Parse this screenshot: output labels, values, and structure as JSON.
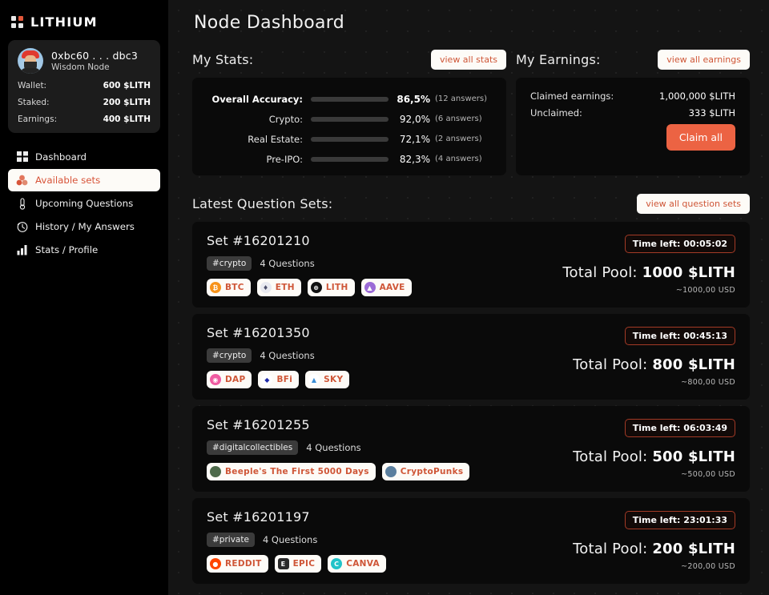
{
  "brand": {
    "name": "LITHIUM",
    "logo_icon": "four-dot-grid-icon",
    "accent": "#e2573a"
  },
  "profile": {
    "address": "0xbc60 . . . dbc3",
    "role": "Wisdom Node",
    "avatar_icon": "user-avatar",
    "rows": [
      {
        "label": "Wallet:",
        "value": "600 $LITH"
      },
      {
        "label": "Staked:",
        "value": "200 $LITH"
      },
      {
        "label": "Earnings:",
        "value": "400 $LITH"
      }
    ]
  },
  "sidebar": {
    "items": [
      {
        "label": "Dashboard",
        "icon": "grid-icon",
        "active": false
      },
      {
        "label": "Available sets",
        "icon": "cubes-icon",
        "active": true
      },
      {
        "label": "Upcoming Questions",
        "icon": "thermometer-icon",
        "active": false
      },
      {
        "label": "History / My Answers",
        "icon": "clock-icon",
        "active": false
      },
      {
        "label": "Stats / Profile",
        "icon": "bar-chart-icon",
        "active": false
      }
    ]
  },
  "header": {
    "title": "Node Dashboard"
  },
  "my_stats": {
    "title": "My Stats:",
    "view_all_label": "view all stats",
    "bar_color": "#e3573c",
    "track_color": "#3a3a3a",
    "rows": [
      {
        "label": "Overall Accuracy:",
        "percent": "86,5%",
        "value": 86.5,
        "answers": "(12 answers)",
        "primary": true
      },
      {
        "label": "Crypto:",
        "percent": "92,0%",
        "value": 92.0,
        "answers": "(6 answers)",
        "primary": false
      },
      {
        "label": "Real Estate:",
        "percent": "72,1%",
        "value": 72.1,
        "answers": "(2 answers)",
        "primary": false
      },
      {
        "label": "Pre-IPO:",
        "percent": "82,3%",
        "value": 82.3,
        "answers": "(4 answers)",
        "primary": false
      }
    ]
  },
  "my_earnings": {
    "title": "My Earnings:",
    "view_all_label": "view all earnings",
    "rows": [
      {
        "label": "Claimed earnings:",
        "value": "1,000,000 $LITH"
      },
      {
        "label": "Unclaimed:",
        "value": "333 $LITH"
      }
    ],
    "claim_label": "Claim all",
    "claim_color": "#ec6343"
  },
  "question_sets": {
    "title": "Latest Question Sets:",
    "view_all_label": "view all question sets",
    "timer_prefix": "Time left: ",
    "pool_prefix": "Total Pool: ",
    "cards": [
      {
        "set_id": "Set #16201210",
        "tag": "#crypto",
        "questions": "4 Questions",
        "timer": "Time left: 00:05:02",
        "pool_label": "Total Pool: ",
        "pool_value": "1000 $LITH",
        "usd": "~1000,00 USD",
        "chips": [
          {
            "label": "BTC",
            "icon": "bitcoin-icon",
            "glyph": "₿",
            "bg": "#f7931a",
            "shape": "circle"
          },
          {
            "label": "ETH",
            "icon": "ethereum-icon",
            "glyph": "♦",
            "bg": "#e9eaf0",
            "fg": "#4c4f6b",
            "shape": "circle"
          },
          {
            "label": "LITH",
            "icon": "lithium-icon",
            "glyph": "⊕",
            "bg": "#111111",
            "shape": "circle"
          },
          {
            "label": "AAVE",
            "icon": "aave-icon",
            "glyph": "▲",
            "bg": "#9b6bd6",
            "shape": "circle"
          }
        ]
      },
      {
        "set_id": "Set #16201350",
        "tag": "#crypto",
        "questions": "4 Questions",
        "timer": "Time left: 00:45:13",
        "pool_label": "Total Pool: ",
        "pool_value": "800 $LITH",
        "usd": "~800,00 USD",
        "chips": [
          {
            "label": "DAP",
            "icon": "dap-icon",
            "glyph": "◉",
            "bg": "#ef5ba1",
            "shape": "circle"
          },
          {
            "label": "BFi",
            "icon": "bfi-icon",
            "glyph": "◆",
            "bg": "#ffffff",
            "fg": "#1f2aa8",
            "shape": "circle"
          },
          {
            "label": "SKY",
            "icon": "sky-icon",
            "glyph": "▲",
            "bg": "#ffffff",
            "fg": "#3b8ed6",
            "shape": "circle"
          }
        ]
      },
      {
        "set_id": "Set #16201255",
        "tag": "#digitalcollectibles",
        "questions": "4 Questions",
        "timer": "Time left: 06:03:49",
        "pool_label": "Total Pool: ",
        "pool_value": "500 $LITH",
        "usd": "~500,00 USD",
        "chips": [
          {
            "label": "Beeple's The First 5000 Days",
            "icon": "beeple-artwork-icon",
            "glyph": "",
            "bg": "#4e6a4a",
            "shape": "circle"
          },
          {
            "label": "CryptoPunks",
            "icon": "cryptopunks-icon",
            "glyph": "",
            "bg": "#5b7f9e",
            "shape": "circle"
          }
        ]
      },
      {
        "set_id": "Set #16201197",
        "tag": "#private",
        "questions": "4 Questions",
        "timer": "Time left: 23:01:33",
        "pool_label": "Total Pool: ",
        "pool_value": "200 $LITH",
        "usd": "~200,00 USD",
        "chips": [
          {
            "label": "REDDIT",
            "icon": "reddit-icon",
            "glyph": "●",
            "bg": "#ff4500",
            "shape": "circle"
          },
          {
            "label": "EPIC",
            "icon": "epic-games-icon",
            "glyph": "E",
            "bg": "#2a2a2a",
            "shape": "sq"
          },
          {
            "label": "CANVA",
            "icon": "canva-icon",
            "glyph": "C",
            "bg": "#21c3c9",
            "shape": "circle"
          }
        ]
      }
    ]
  }
}
